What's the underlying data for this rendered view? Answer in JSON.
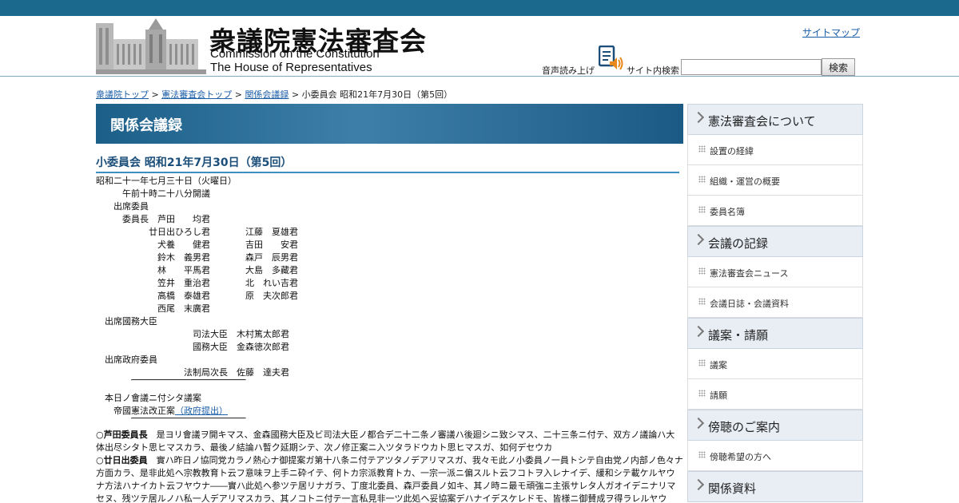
{
  "header": {
    "site_title": "衆議院憲法審査会",
    "site_title_en_line1": "Commission on the Constitution",
    "site_title_en_line2": "The House of  Representatives",
    "sitemap_link": "サイトマップ",
    "voice_read_label": "音声読み上げ",
    "search_label": "サイト内検索",
    "search_value": "",
    "search_button": "検索"
  },
  "breadcrumb": {
    "items": [
      "衆議院トップ",
      "憲法審査会トップ",
      "関係会議録"
    ],
    "separator": ">",
    "current": "小委員会 昭和21年7月30日（第5回）"
  },
  "section": {
    "banner_title": "関係会議録"
  },
  "page": {
    "title": "小委員会 昭和21年7月30日（第5回）"
  },
  "minutes": {
    "lines": [
      "昭和二十一年七月三十日（火曜日）",
      "　　　午前十時二十八分開議",
      "　　出席委員",
      "　　　委員長　芦田　　均君",
      "　　　　　　廿日出ひろし君　　　　江藤　夏雄君",
      "　　　　　　　犬養　　健君　　　　吉田　　安君",
      "　　　　　　　鈴木　義男君　　　　森戸　辰男君",
      "　　　　　　　林　　平馬君　　　　大島　多藏君",
      "　　　　　　　笠井　重治君　　　　北　れい吉君",
      "　　　　　　　高橋　泰雄君　　　　原　夫次郎君",
      "　　　　　　　西尾　末廣君",
      "　出席國務大臣",
      "　　　　　　　　　　　司法大臣　木村篤太郎君",
      "　　　　　　　　　　　國務大臣　金森徳次郎君",
      "　出席政府委員",
      "　　　　　　　　　　法制局次長　佐藤　達夫君"
    ],
    "agenda_heading": "　本日ノ會議ニ付シタ議案",
    "agenda_item": "　　帝國憲法改正案",
    "agenda_link": "（政府提出）",
    "speeches": [
      {
        "speaker": "○芦田委員長",
        "text": "　是ヨリ會議ヲ開キマス、金森國務大臣及ビ司法大臣ノ都合デ二十二条ノ審議ハ後廻シニ致シマス、二十三条ニ付テ、双方ノ議論ハ大体出尽シタト思ヒマスカラ、最後ノ結論ハ暫ク延期シテ、次ノ修正案ニ入ツタラドウカト思ヒマスガ、如何デセウカ"
      },
      {
        "speaker": "○廿日出委員",
        "text": "　實ハ昨日ノ協同党カラノ熱心ナ御提案ガ第十八条ニ付テアツタノデアリマスガ、我々モ此ノ小委員ノ一員トシテ自由党ノ内部ノ色々ナ方面カラ、是非此処ヘ宗教教育ト云フ意味ヲ上手ニ砕イテ、何トカ宗派教育トカ、一宗一派ニ偏スルト云フコトヲ入レナイデ、緩和シテ載ケルヤウナ方法ハナイカト云フヤウナ――實ハ此処ヘ参ツテ居リナガラ、丁度北委員、森戸委員ノ如キ、其ノ時ニ最モ頑強ニ主張サレタ人ガオイデニナリマセヌ、残ツテ居ルノハ私一人デアリマスカラ、其ノコトニ付テ一言私見非一ツ此処ヘ妥協案デハナイデスケレドモ、皆様ニ御賛成ヲ得ラレルヤウ"
      }
    ]
  },
  "sidebar": {
    "sections": [
      {
        "heading": "憲法審査会について",
        "items": [
          "設置の経緯",
          "組織・運営の概要",
          "委員名簿"
        ]
      },
      {
        "heading": "会議の記録",
        "items": [
          "憲法審査会ニュース",
          "会議日誌・会議資料"
        ]
      },
      {
        "heading": "議案・請願",
        "items": [
          "議案",
          "請願"
        ]
      },
      {
        "heading": "傍聴のご案内",
        "items": [
          "傍聴希望の方へ"
        ]
      },
      {
        "heading": "関係資料",
        "items": []
      }
    ]
  },
  "colors": {
    "top_bar": "#1b6a8e",
    "banner": "#2e6e98",
    "link": "#1a5ea8",
    "title_text": "#1b4f7a",
    "sidebar_heading_bg": "#e9eef5"
  },
  "icons": {
    "voice": "speaker-document-icon",
    "logo": "diet-building-icon",
    "sidebar_heading": "chevron-right-icon",
    "sidebar_item": "dotted-square-icon"
  }
}
